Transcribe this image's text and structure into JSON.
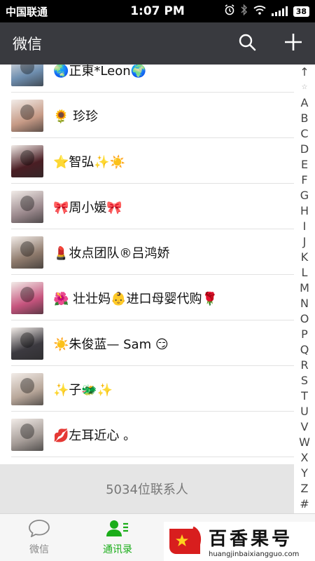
{
  "status_bar": {
    "carrier": "中国联通",
    "time": "1:07 PM",
    "battery": "38"
  },
  "nav": {
    "title": "微信",
    "search_icon": "search-icon",
    "add_icon": "plus-icon"
  },
  "contacts": [
    {
      "name": "🌏正東*Leon🌍",
      "avatar_color": "#6f8fb0"
    },
    {
      "name": "🌻 珍珍",
      "avatar_color": "#c69a86"
    },
    {
      "name": "⭐智弘✨☀️",
      "avatar_color": "#4a1e24"
    },
    {
      "name": "🎀周小媛🎀",
      "avatar_color": "#9c8a8e"
    },
    {
      "name": "💄妆点团队®吕鸿娇",
      "avatar_color": "#8e7a6c"
    },
    {
      "name": "🌺 壮壮妈👶进口母婴代购🌹",
      "avatar_color": "#c6547e"
    },
    {
      "name": "☀️朱俊蓝— Sam 😏",
      "avatar_color": "#3c3a40"
    },
    {
      "name": "✨子🐲✨",
      "avatar_color": "#b8a79a"
    },
    {
      "name": "    💋左耳近心  。",
      "avatar_color": "#a59c97"
    }
  ],
  "index_letters": [
    "↑",
    "☆",
    "A",
    "B",
    "C",
    "D",
    "E",
    "F",
    "G",
    "H",
    "I",
    "J",
    "K",
    "L",
    "M",
    "N",
    "O",
    "P",
    "Q",
    "R",
    "S",
    "T",
    "U",
    "V",
    "W",
    "X",
    "Y",
    "Z",
    "#"
  ],
  "footer": {
    "count_text": "5034位联系人"
  },
  "tabs": [
    {
      "label": "微信",
      "icon": "chat-bubble-icon",
      "active": false
    },
    {
      "label": "通讯录",
      "icon": "contacts-icon",
      "active": true
    }
  ],
  "watermark": {
    "title": "百香果号",
    "url": "huangjinbaixiangguo.com"
  },
  "colors": {
    "nav_bg": "#393a3f",
    "accent_green": "#1aad19",
    "footer_bg": "#e5e5e5"
  }
}
